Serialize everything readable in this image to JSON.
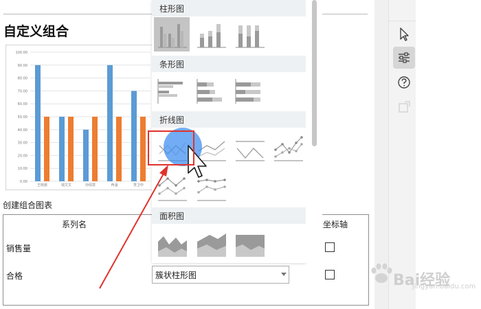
{
  "dialog": {
    "title": "自定义组合",
    "combo_label": "创建组合图表",
    "table": {
      "header_name": "系列名",
      "header_axis": "次坐标轴",
      "rows": [
        {
          "name": "销售量"
        },
        {
          "name": "合格"
        }
      ]
    },
    "type_select": {
      "value": "簇状柱形图"
    }
  },
  "gallery": {
    "sections": [
      "柱形图",
      "条形图",
      "折线图",
      "面积图"
    ]
  },
  "right_panel": {
    "tools": [
      "cursor-icon",
      "settings-sliders-icon",
      "help-icon",
      "disabled-icon"
    ]
  },
  "watermark": {
    "text": "Bai经验",
    "url": "jingyan.baidu.com"
  },
  "colors": {
    "series_blue": "#5b9bd5",
    "series_orange": "#ed7d31",
    "highlight_red": "#e0322c",
    "section_bg": "#eef1f3"
  },
  "chart_data": {
    "type": "bar",
    "categories": [
      "王晓晨",
      "钱文文",
      "孙倩慧",
      "冉涵",
      "李卫中"
    ],
    "series": [
      {
        "values": [
          90,
          50,
          40,
          90,
          70
        ]
      },
      {
        "values": [
          50,
          50,
          50,
          50,
          50
        ]
      }
    ],
    "ylim": [
      0,
      100
    ],
    "y_ticks": [
      "0.00",
      "10.00",
      "20.00",
      "30.00",
      "40.00",
      "50.00",
      "60.00",
      "70.00",
      "80.00",
      "90.00",
      "100.00"
    ],
    "grid": true
  }
}
